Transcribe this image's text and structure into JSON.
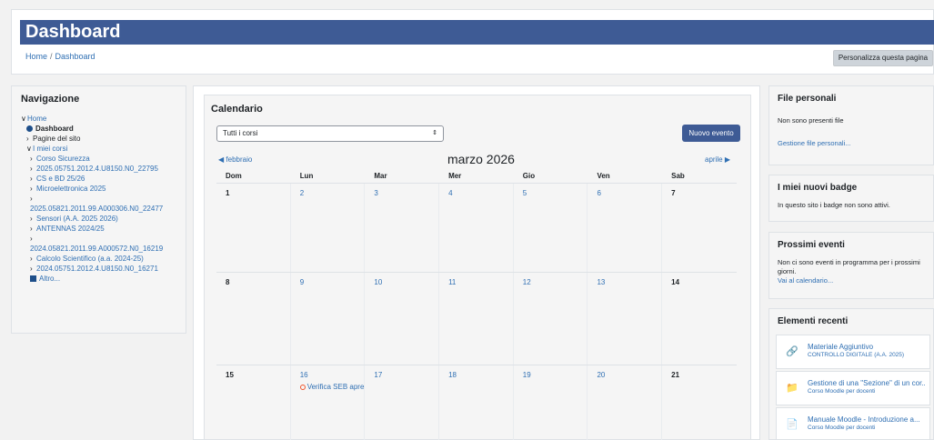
{
  "header": {
    "title": "Dashboard",
    "breadcrumb": [
      "Home",
      "Dashboard"
    ],
    "customize_button": "Personalizza questa pagina"
  },
  "navigation": {
    "title": "Navigazione",
    "home": "Home",
    "dashboard": "Dashboard",
    "site_pages": "Pagine del sito",
    "my_courses": "I miei corsi",
    "courses": [
      "Corso Sicurezza",
      "2025.05751.2012.4.U8150.N0_22795",
      "CS e BD 25/26",
      "Microelettronica 2025",
      "2025.05821.2011.99.A000306.N0_22477",
      "Sensori (A.A. 2025 2026)",
      "ANTENNAS 2024/25",
      "2024.05821.2011.99.A000572.N0_16219",
      "Calcolo Scientifico (a.a. 2024-25)",
      "2024.05751.2012.4.U8150.N0_16271"
    ],
    "more": "Altro..."
  },
  "calendar": {
    "title": "Calendario",
    "course_filter": "Tutti i corsi",
    "new_event_button": "Nuovo evento",
    "prev_month": "febbraio",
    "next_month": "aprile",
    "month_title": "marzo 2026",
    "weekdays": [
      "Dom",
      "Lun",
      "Mar",
      "Mer",
      "Gio",
      "Ven",
      "Sab"
    ],
    "weeks": [
      [
        "1",
        "2",
        "3",
        "4",
        "5",
        "6",
        "7"
      ],
      [
        "8",
        "9",
        "10",
        "11",
        "12",
        "13",
        "14"
      ],
      [
        "15",
        "16",
        "17",
        "18",
        "19",
        "20",
        "21"
      ]
    ],
    "event_day16": "Verifica SEB apre"
  },
  "private_files": {
    "title": "File personali",
    "empty_text": "Non sono presenti file",
    "manage_link": "Gestione file personali..."
  },
  "badges": {
    "title": "I miei nuovi badge",
    "text": "In questo sito i badge non sono attivi."
  },
  "upcoming": {
    "title": "Prossimi eventi",
    "text": "Non ci sono eventi in programma per i prossimi giorni.",
    "link": "Vai al calendario..."
  },
  "recent": {
    "title": "Elementi recenti",
    "items": [
      {
        "name": "Materiale Aggiuntivo",
        "course": "CONTROLLO DIGITALE (A.A. 2025)",
        "icon": "link-icon"
      },
      {
        "name": "Gestione di una \"Sezione\" di un cor...",
        "course": "Corso Moodle per docenti",
        "icon": "folder-icon"
      },
      {
        "name": "Manuale Moodle - Introduzione a...",
        "course": "Corso Moodle per docenti",
        "icon": "pdf-icon"
      }
    ]
  }
}
